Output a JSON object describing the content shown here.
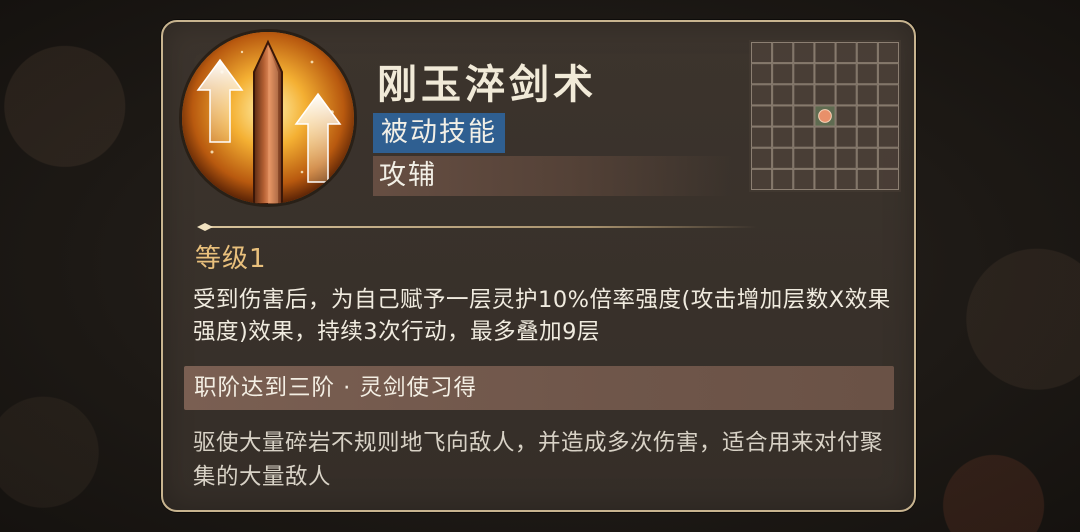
{
  "skill": {
    "name": "刚玉淬剑术",
    "category": "被动技能",
    "type": "攻辅",
    "icon": "upward-sword-buff-icon",
    "level": "等级1",
    "description": "受到伤害后，为自己赋予一层灵护10%倍率强度(攻击增加层数X效果强度)效果，持续3次行动，最多叠加9层",
    "requirement": "职阶达到三阶 · 灵剑使习得",
    "flavor": "驱使大量碎岩不规则地飞向敌人，并造成多次伤害，适合用来对付聚集的大量敌人"
  },
  "range_grid": {
    "rows": 7,
    "cols": 7,
    "target_row": 3,
    "target_col": 3
  },
  "colors": {
    "border": "#c8b48f",
    "passive_tag": "#2f5f91",
    "level_text": "#e9c07c",
    "target_cell": "#e8906a"
  }
}
